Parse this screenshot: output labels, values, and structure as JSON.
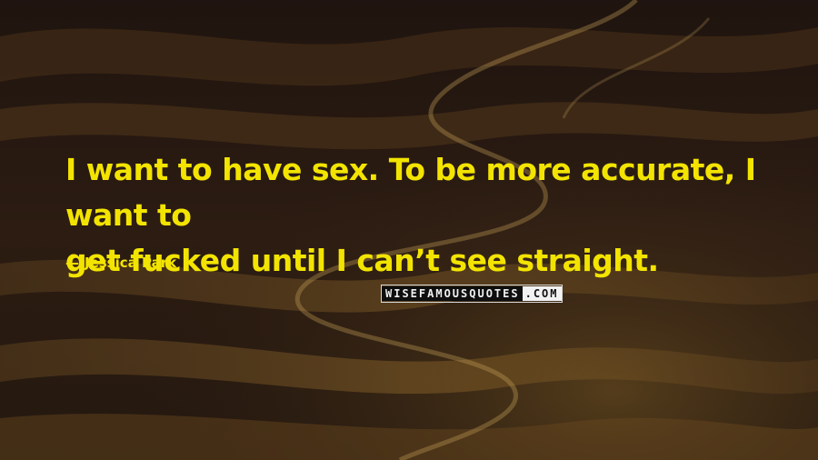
{
  "quote": {
    "line1": "I want to have sex. To be more accurate, I want to",
    "line2": "get fucked until I can’t see straight."
  },
  "author": {
    "dash": "—",
    "name": "Jessica Park"
  },
  "watermark": {
    "main": "WISEFAMOUSQUOTES",
    "tld": ".COM"
  },
  "colors": {
    "quote_text": "#f3e400",
    "background_dark": "#2a1a12",
    "background_light": "#b7862c"
  }
}
